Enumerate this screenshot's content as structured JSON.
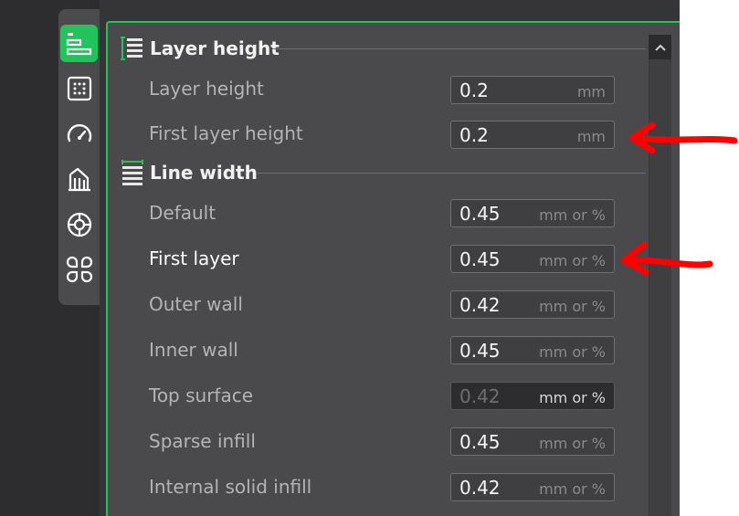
{
  "sidebar": {
    "items": [
      {
        "icon": "quality-icon",
        "active": true
      },
      {
        "icon": "strength-icon",
        "active": false
      },
      {
        "icon": "speed-icon",
        "active": false
      },
      {
        "icon": "support-icon",
        "active": false
      },
      {
        "icon": "multimaterial-icon",
        "active": false
      },
      {
        "icon": "others-icon",
        "active": false
      }
    ]
  },
  "sections": {
    "layer_height": {
      "title": "Layer height",
      "icon": "layer-height-icon",
      "rows": [
        {
          "label": "Layer height",
          "value": "0.2",
          "unit": "mm"
        },
        {
          "label": "First layer height",
          "value": "0.2",
          "unit": "mm"
        }
      ]
    },
    "line_width": {
      "title": "Line width",
      "icon": "line-width-icon",
      "rows": [
        {
          "label": "Default",
          "value": "0.45",
          "unit": "mm or %"
        },
        {
          "label": "First layer",
          "value": "0.45",
          "unit": "mm or %"
        },
        {
          "label": "Outer wall",
          "value": "0.42",
          "unit": "mm or %"
        },
        {
          "label": "Inner wall",
          "value": "0.45",
          "unit": "mm or %"
        },
        {
          "label": "Top surface",
          "value": "0.42",
          "unit": "mm or %"
        },
        {
          "label": "Sparse infill",
          "value": "0.45",
          "unit": "mm or %"
        },
        {
          "label": "Internal solid infill",
          "value": "0.42",
          "unit": "mm or %"
        }
      ]
    }
  },
  "colors": {
    "accent": "#22c35a",
    "panel": "#4a4a4c",
    "annotation_arrow": "#ff0000"
  }
}
